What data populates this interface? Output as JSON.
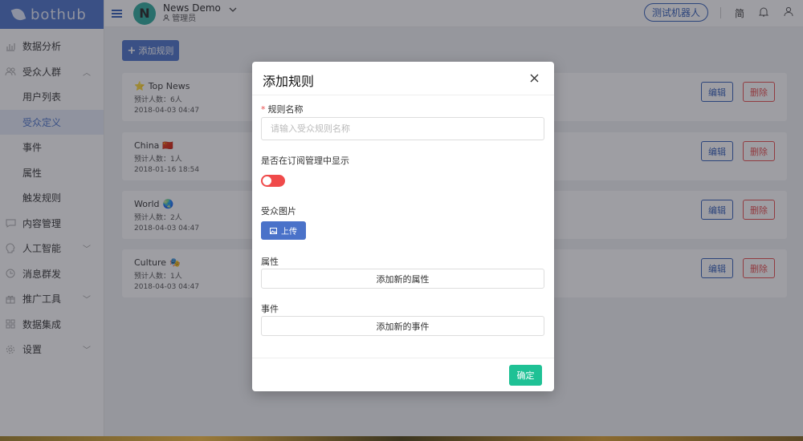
{
  "brand": {
    "name": "bothub"
  },
  "header": {
    "avatar_letter": "N",
    "org_name": "News Demo",
    "org_role": "管理员",
    "test_button": "测试机器人",
    "lang": "简"
  },
  "sidebar": {
    "items": [
      {
        "label": "数据分析",
        "icon": "chart-icon",
        "level": "top",
        "chevron": false
      },
      {
        "label": "受众人群",
        "icon": "people-icon",
        "level": "top",
        "chevron": true
      },
      {
        "label": "用户列表",
        "level": "sub"
      },
      {
        "label": "受众定义",
        "level": "sub",
        "active": true
      },
      {
        "label": "事件",
        "level": "sub"
      },
      {
        "label": "属性",
        "level": "sub"
      },
      {
        "label": "触发规则",
        "level": "sub"
      },
      {
        "label": "内容管理",
        "icon": "chat-icon",
        "level": "top",
        "chevron": false
      },
      {
        "label": "人工智能",
        "icon": "brain-icon",
        "level": "top",
        "chevron": true
      },
      {
        "label": "消息群发",
        "icon": "clock-icon",
        "level": "top",
        "chevron": false
      },
      {
        "label": "推广工具",
        "icon": "gift-icon",
        "level": "top",
        "chevron": true
      },
      {
        "label": "数据集成",
        "icon": "grid-icon",
        "level": "top",
        "chevron": false
      },
      {
        "label": "设置",
        "icon": "gear-icon",
        "level": "top",
        "chevron": true
      }
    ]
  },
  "main": {
    "add_rule_button": "添加规则",
    "edit_label": "编辑",
    "delete_label": "删除",
    "rules": [
      {
        "title": "Top News",
        "emoji_before": "⭐",
        "emoji_after": "",
        "count": "预计人数：6人",
        "time": "2018-04-03 04:47"
      },
      {
        "title": "China",
        "emoji_before": "",
        "emoji_after": "🇨🇳",
        "count": "预计人数：1人",
        "time": "2018-01-16 18:54"
      },
      {
        "title": "World",
        "emoji_before": "",
        "emoji_after": "🌏",
        "count": "预计人数：2人",
        "time": "2018-04-03 04:47"
      },
      {
        "title": "Culture",
        "emoji_before": "",
        "emoji_after": "🎭",
        "count": "预计人数：1人",
        "time": "2018-04-03 04:47"
      }
    ]
  },
  "modal": {
    "title": "添加规则",
    "name_label": "规则名称",
    "name_required_mark": "*",
    "name_placeholder": "请输入受众规则名称",
    "name_value": "",
    "show_label": "是否在订阅管理中显示",
    "show_enabled": false,
    "image_label": "受众图片",
    "upload_button": "上传",
    "attr_label": "属性",
    "attr_button": "添加新的属性",
    "event_label": "事件",
    "event_button": "添加新的事件",
    "ok_button": "确定"
  },
  "colors": {
    "brand": "#4a72c9",
    "primary_outline": "#2f5bb7",
    "danger": "#e84b4b",
    "toggle": "#f04a4a",
    "confirm": "#1fc195"
  }
}
